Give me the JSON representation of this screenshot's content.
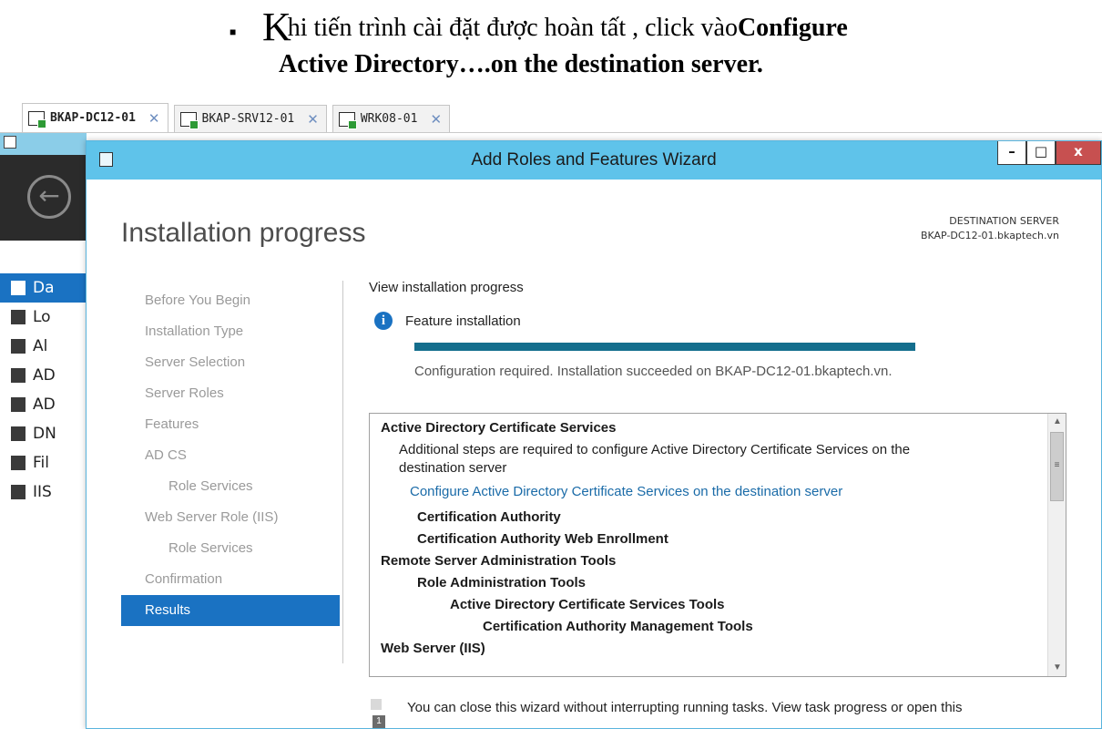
{
  "caption": {
    "dropcap": "K",
    "line1_rest": "hi tiến trình cài đặt được hoàn tất , click vào ",
    "line1_bold": "Configure",
    "line2": "Active Directory….on the destination server."
  },
  "remote_tabs": [
    {
      "label": "BKAP-DC12-01",
      "active": true
    },
    {
      "label": "BKAP-SRV12-01",
      "active": false
    },
    {
      "label": "WRK08-01",
      "active": false
    }
  ],
  "server_manager": {
    "nav": [
      "Da",
      "Lo",
      "Al",
      "AD",
      "AD",
      "DN",
      "Fil",
      "IIS"
    ]
  },
  "wizard": {
    "title": "Add Roles and Features Wizard",
    "heading": "Installation progress",
    "destination_label": "DESTINATION SERVER",
    "destination_value": "BKAP-DC12-01.bkaptech.vn",
    "steps": [
      {
        "label": "Before You Begin"
      },
      {
        "label": "Installation Type"
      },
      {
        "label": "Server Selection"
      },
      {
        "label": "Server Roles"
      },
      {
        "label": "Features"
      },
      {
        "label": "AD CS"
      },
      {
        "label": "Role Services"
      },
      {
        "label": "Web Server Role (IIS)"
      },
      {
        "label": "Role Services"
      },
      {
        "label": "Confirmation"
      },
      {
        "label": "Results"
      }
    ],
    "view_label": "View installation progress",
    "feature_label": "Feature installation",
    "progress_percent": 100,
    "status": "Configuration required. Installation succeeded on BKAP-DC12-01.bkaptech.vn.",
    "results": {
      "adcs_title": "Active Directory Certificate Services",
      "adcs_desc": "Additional steps are required to configure Active Directory Certificate Services on the destination server",
      "adcs_link": "Configure Active Directory Certificate Services on the destination server",
      "ca": "Certification Authority",
      "ca_web": "Certification Authority Web Enrollment",
      "rsat": "Remote Server Administration Tools",
      "rat": "Role Administration Tools",
      "adcs_tools": "Active Directory Certificate Services Tools",
      "ca_mgmt": "Certification Authority Management Tools",
      "iis": "Web Server (IIS)"
    },
    "footnote": "You can close this wizard without interrupting running tasks. View task progress or open this"
  },
  "colors": {
    "titlebar": "#5fc3ea",
    "selected": "#1a72c2",
    "progress": "#146e8d",
    "link": "#1a6ba8",
    "close_button": "#c75050"
  }
}
